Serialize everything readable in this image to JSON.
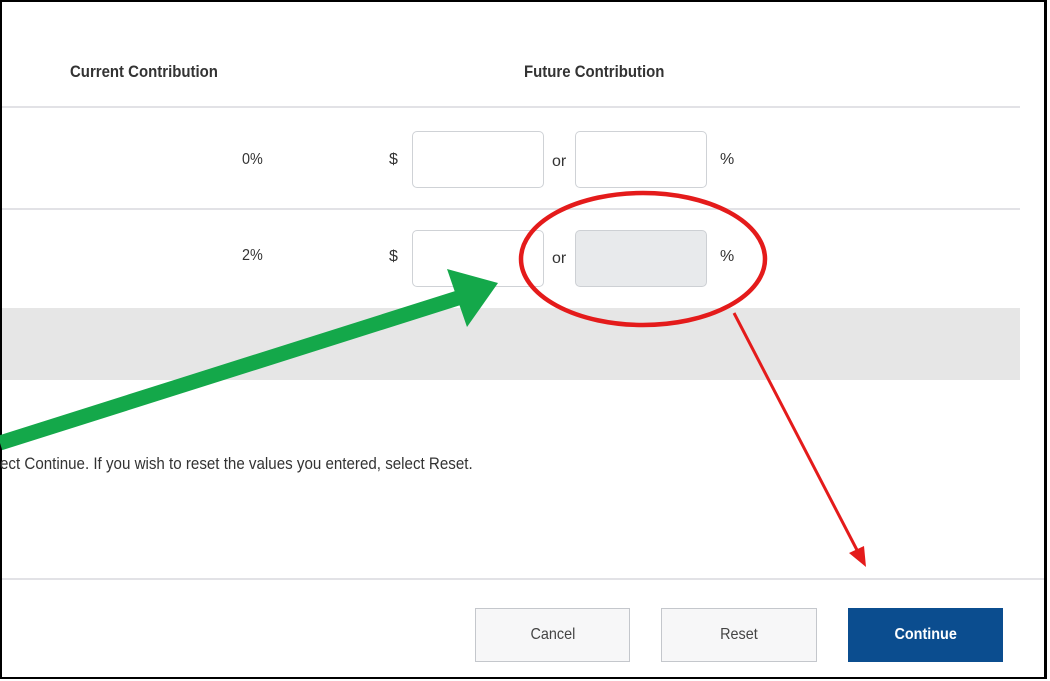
{
  "table": {
    "headers": {
      "current": "Current Contribution",
      "future": "Future Contribution"
    },
    "rows": [
      {
        "current_value": "0%",
        "dollar_symbol": "$",
        "or_label": "or",
        "percent_symbol": "%",
        "dollar_value": "",
        "percent_value": "",
        "percent_disabled": false
      },
      {
        "current_value": "2%",
        "dollar_symbol": "$",
        "or_label": "or",
        "percent_symbol": "%",
        "dollar_value": "",
        "percent_value": "",
        "percent_disabled": true
      }
    ]
  },
  "instructions": "ect Continue. If you wish to reset the values you entered, select Reset.",
  "buttons": {
    "cancel": "Cancel",
    "reset": "Reset",
    "continue": "Continue"
  },
  "colors": {
    "primary_button": "#0b4d8f",
    "annotation_green_arrow": "#14a84a",
    "annotation_red_circle": "#e41b1b"
  },
  "annotations": {
    "green_arrow": "arrow pointing to dollar input of second row",
    "red_circle": "circle around disabled percent input of second row",
    "red_arrow": "arrow pointing to Continue button"
  }
}
